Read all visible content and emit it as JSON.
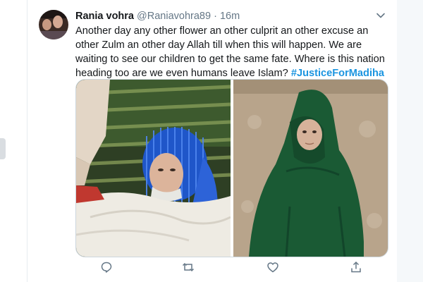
{
  "tweet": {
    "author_name": "Rania vohra",
    "handle": "@Raniavohra89",
    "separator": "·",
    "time": "16m",
    "text_main": "Another day any other flower an other culprit an other excuse an other Zulm an other day Allah till when this will happen. We are waiting to see our children to get the same fate. Where is this nation heading too are we even humans leave Islam?",
    "hashtag": "#JusticeForMadiha"
  },
  "icons": {
    "caret": "chevron-down-icon",
    "reply": "reply-icon",
    "retweet": "retweet-icon",
    "like": "heart-icon",
    "share": "share-icon"
  },
  "colors": {
    "hashtag": "#1b95e0",
    "text": "#14171a",
    "muted": "#657786"
  }
}
